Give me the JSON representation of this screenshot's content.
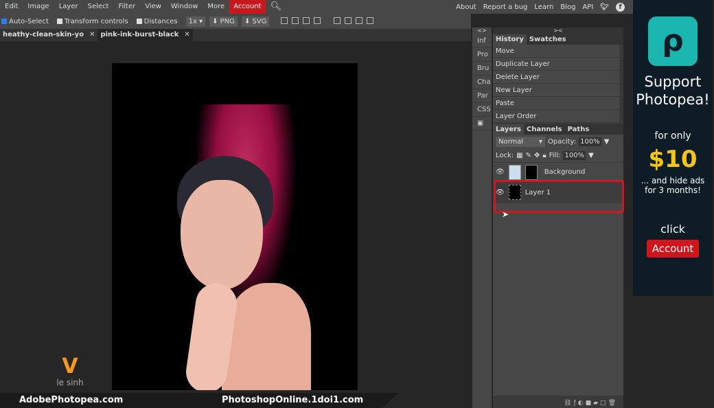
{
  "menu": {
    "items": [
      "Edit",
      "Image",
      "Layer",
      "Select",
      "Filter",
      "View",
      "Window",
      "More"
    ],
    "account": "Account",
    "links": [
      "About",
      "Report a bug",
      "Learn",
      "Blog",
      "API"
    ]
  },
  "toolbar": {
    "auto_select": "Auto-Select",
    "transform": "Transform controls",
    "distances": "Distances",
    "scale": "1x",
    "png": "PNG",
    "svg": "SVG"
  },
  "tabs": [
    {
      "label": "heathy-clean-skin-yo"
    },
    {
      "label": "pink-ink-burst-black"
    }
  ],
  "side": [
    "Inf",
    "Pro",
    "Bru",
    "Cha",
    "Par",
    "CSS"
  ],
  "history": {
    "tabs": [
      "History",
      "Swatches"
    ],
    "items": [
      "Move",
      "Duplicate Layer",
      "Delete Layer",
      "New Layer",
      "Paste",
      "Layer Order"
    ]
  },
  "layers": {
    "tabs": [
      "Layers",
      "Channels",
      "Paths"
    ],
    "blend": "Normal",
    "opacity_label": "Opacity:",
    "opacity": "100%",
    "lock_label": "Lock:",
    "fill_label": "Fill:",
    "fill": "100%",
    "items": [
      "Background",
      "Layer 1"
    ]
  },
  "ad": {
    "line1": "Support",
    "line2": "Photopea!",
    "for": "for only",
    "price": "$10",
    "hide": "... and hide ads",
    "months": "for 3 months!",
    "click": "click",
    "button": "Account"
  },
  "watermark": {
    "logo": "le sinh",
    "left": "AdobePhotopea.com",
    "right": "PhotoshopOnline.1doi1.com"
  }
}
